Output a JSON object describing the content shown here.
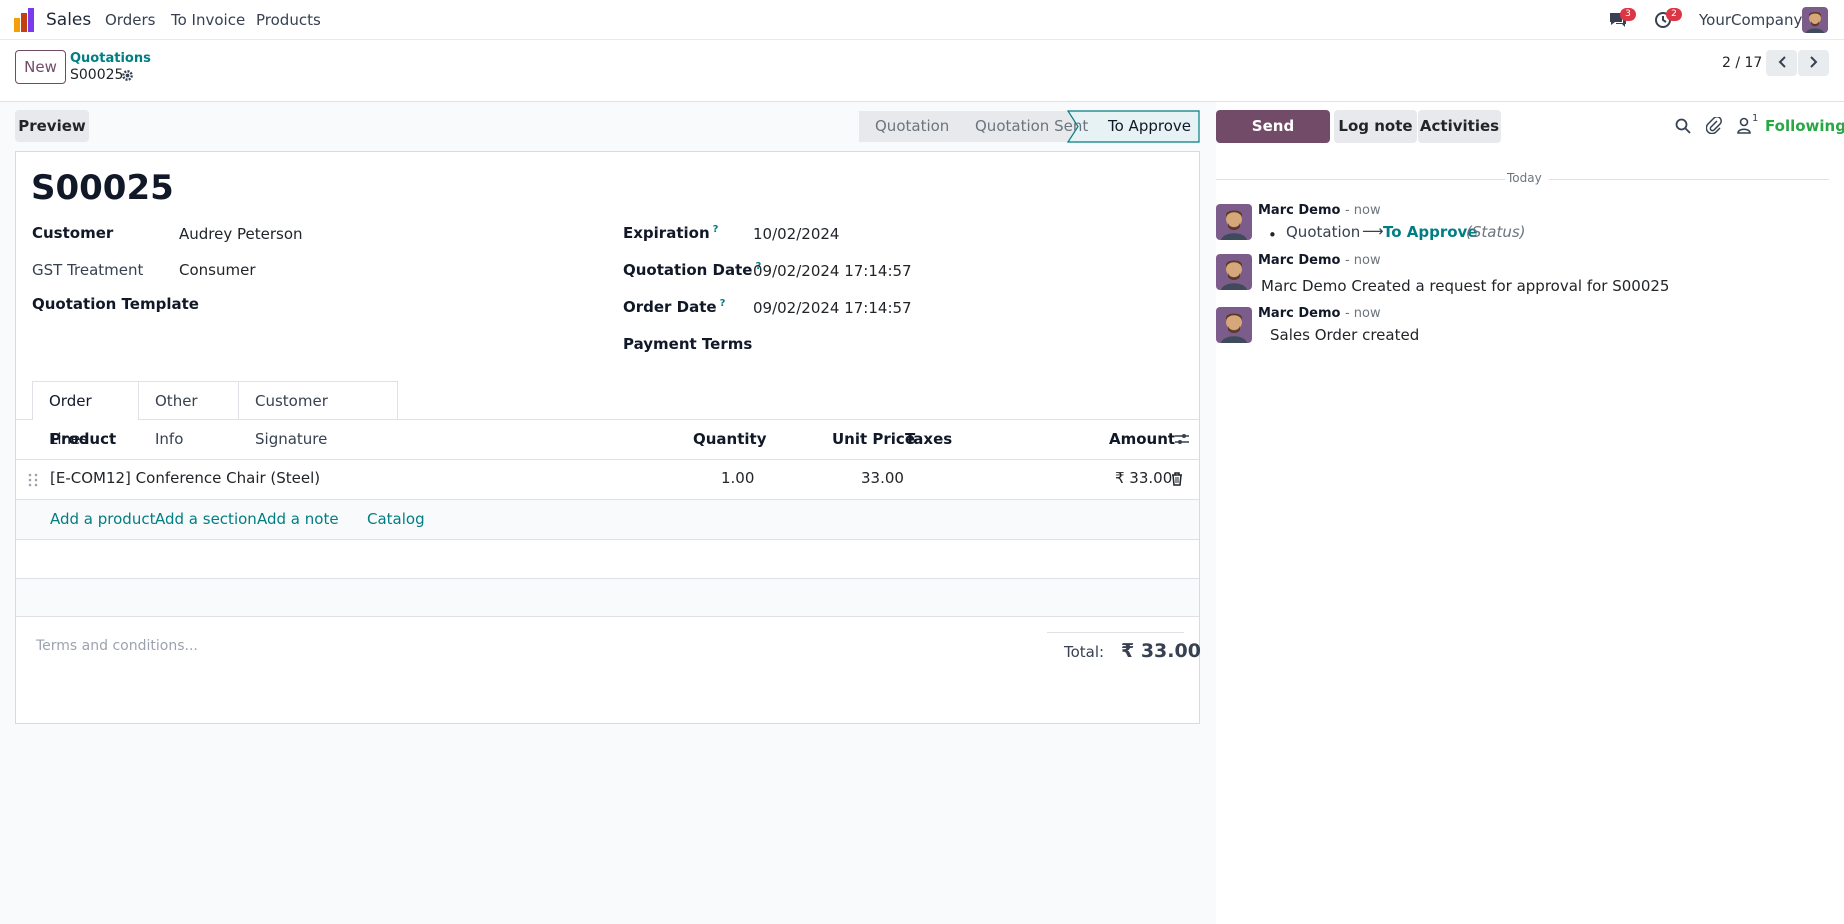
{
  "navbar": {
    "app_name": "Sales",
    "menu": [
      "Orders",
      "To Invoice",
      "Products"
    ],
    "messages_count": "3",
    "activities_count": "2",
    "company": "YourCompany"
  },
  "control": {
    "new_label": "New",
    "breadcrumb": "Quotations",
    "record": "S00025",
    "pager": "2 / 17"
  },
  "actions": {
    "preview": "Preview",
    "stages": [
      "Quotation",
      "Quotation Sent",
      "To Approve"
    ]
  },
  "form": {
    "title": "S00025",
    "customer_label": "Customer",
    "customer": "Audrey Peterson",
    "gst_label": "GST Treatment",
    "gst": "Consumer",
    "template_label": "Quotation Template",
    "expiration_label": "Expiration",
    "expiration": "10/02/2024",
    "quotation_date_label": "Quotation Date",
    "quotation_date": "09/02/2024 17:14:57",
    "order_date_label": "Order Date",
    "order_date": "09/02/2024 17:14:57",
    "payment_terms_label": "Payment Terms",
    "help_mark": "?"
  },
  "tabs": [
    "Order Lines",
    "Other Info",
    "Customer Signature"
  ],
  "lines": {
    "headers": {
      "product": "Product",
      "quantity": "Quantity",
      "unit_price": "Unit Price",
      "taxes": "Taxes",
      "amount": "Amount"
    },
    "rows": [
      {
        "product": "[E-COM12] Conference Chair (Steel)",
        "quantity": "1.00",
        "unit_price": "33.00",
        "amount": "₹ 33.00"
      }
    ],
    "add_product": "Add a product",
    "add_section": "Add a section",
    "add_note": "Add a note",
    "catalog": "Catalog"
  },
  "footer": {
    "terms_placeholder": "Terms and conditions...",
    "total_label": "Total:",
    "total": "₹ 33.00"
  },
  "chatter": {
    "send_message": "Send message",
    "log_note": "Log note",
    "activities": "Activities",
    "followers_count": "1",
    "following": "Following",
    "date_sep": "Today",
    "messages": [
      {
        "author": "Marc Demo",
        "time": "- now",
        "old": "Quotation",
        "new": "To Approve",
        "field": "(Status)"
      },
      {
        "author": "Marc Demo",
        "time": "- now",
        "body": "Marc Demo Created a request for approval for S00025"
      },
      {
        "author": "Marc Demo",
        "time": "- now",
        "body": "Sales Order created"
      }
    ]
  },
  "colors": {
    "brand": "#714b67",
    "link": "#017e84",
    "success": "#28a745"
  }
}
